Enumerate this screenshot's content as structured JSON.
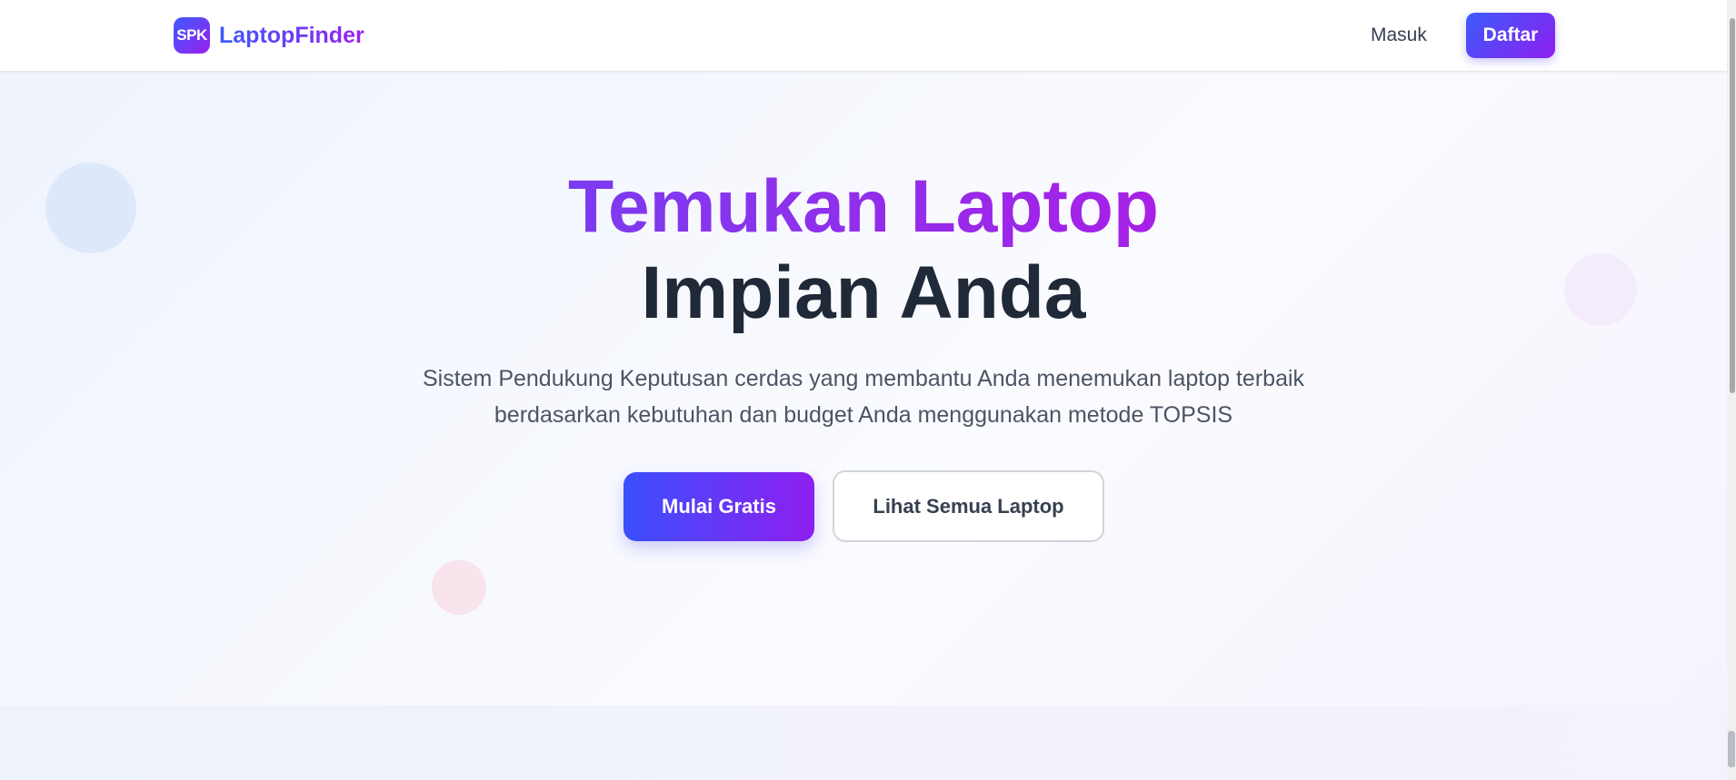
{
  "navbar": {
    "logo_text": "SPK",
    "brand_name": "LaptopFinder",
    "login_label": "Masuk",
    "register_label": "Daftar"
  },
  "hero": {
    "headline_line1": "Temukan Laptop",
    "headline_line2": "Impian Anda",
    "subtitle": "Sistem Pendukung Keputusan cerdas yang membantu Anda menemukan laptop terbaik berdasarkan kebutuhan dan budget Anda menggunakan metode TOPSIS",
    "primary_cta": "Mulai Gratis",
    "secondary_cta": "Lihat Semua Laptop"
  },
  "colors": {
    "accent_start": "#3b5bfd",
    "accent_end": "#9b1fef",
    "heading_dark": "#1f2937",
    "text_muted": "#4b5563"
  }
}
